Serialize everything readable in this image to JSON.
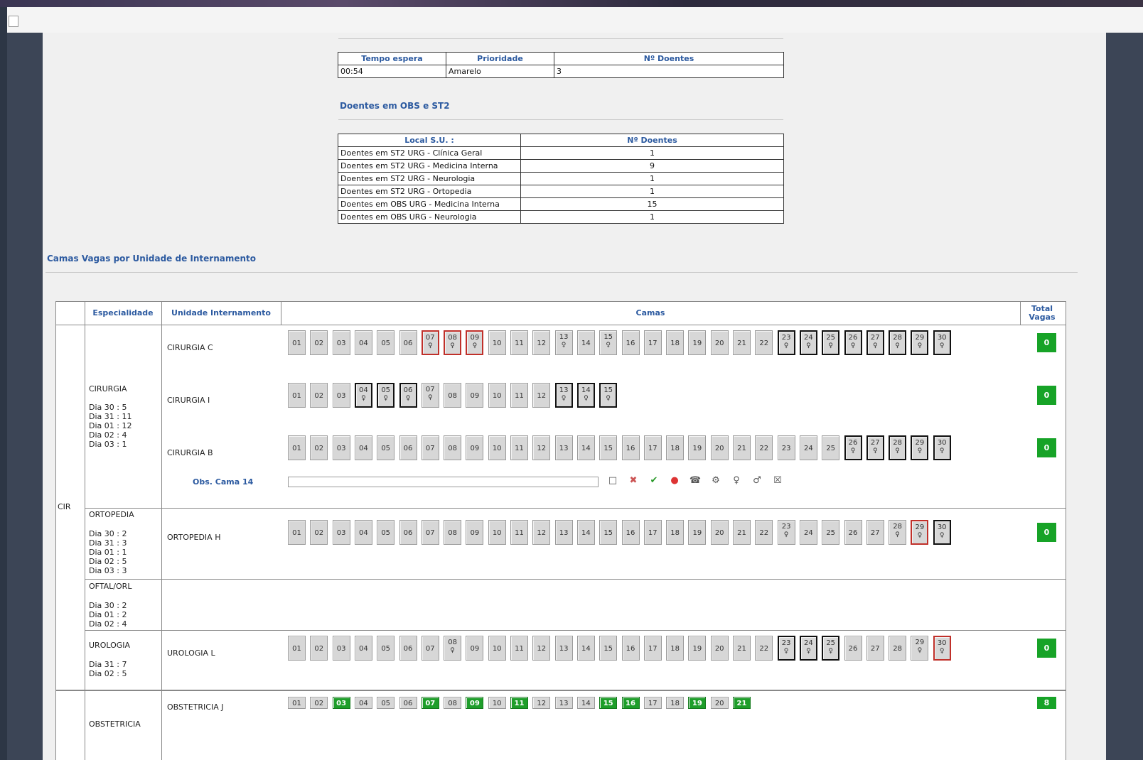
{
  "wait_table": {
    "headers": [
      "Tempo espera",
      "Prioridade",
      "Nº Doentes"
    ],
    "row": [
      "00:54",
      "Amarelo",
      "3"
    ]
  },
  "obs_section": {
    "title": "Doentes em OBS e ST2",
    "headers": [
      "Local S.U. :",
      "Nº Doentes"
    ],
    "rows": [
      [
        "Doentes em ST2 URG - Clínica Geral",
        "1"
      ],
      [
        "Doentes em ST2 URG - Medicina Interna",
        "9"
      ],
      [
        "Doentes em ST2 URG - Neurologia",
        "1"
      ],
      [
        "Doentes em ST2 URG - Ortopedia",
        "1"
      ],
      [
        "Doentes em OBS URG - Medicina Interna",
        "15"
      ],
      [
        "Doentes em OBS URG - Neurologia",
        "1"
      ]
    ]
  },
  "beds_section": {
    "title": "Camas Vagas por Unidade de Internamento",
    "headers": {
      "especialidade": "Especialidade",
      "unidade": "Unidade Internamento",
      "camas": "Camas",
      "total": "Total Vagas"
    },
    "group": "CIR",
    "specialties": [
      {
        "name": "CIRURGIA",
        "stats": "Dia 30 : 5\nDia 31 : 11\nDia 01 : 12\nDia 02 : 4\nDia 03 : 1"
      },
      {
        "name": "ORTOPEDIA",
        "stats": "Dia 30 : 2\nDia 31 : 3\nDia 01 : 1\nDia 02 : 5\nDia 03 : 3"
      },
      {
        "name": "OFTAL/ORL",
        "stats": "Dia 30 : 2\nDia 01 : 2\nDia 02 : 4"
      },
      {
        "name": "UROLOGIA",
        "stats": "Dia 31 : 7\nDia 02 : 5"
      },
      {
        "name": "OBSTETRICIA",
        "stats": ""
      }
    ],
    "units": [
      {
        "name": "CIRURGIA C",
        "total": "0",
        "beds": [
          "01",
          "02",
          "03",
          "04",
          "05",
          "06",
          "07",
          "08",
          "09",
          "10",
          "11",
          "12",
          "13",
          "14",
          "15",
          "16",
          "17",
          "18",
          "19",
          "20",
          "21",
          "22",
          "23",
          "24",
          "25",
          "26",
          "27",
          "28",
          "29",
          "30"
        ],
        "occupied": [
          "13",
          "15"
        ],
        "occupied_bold": [
          "23",
          "24",
          "25",
          "26",
          "27",
          "28",
          "29",
          "30"
        ],
        "red": [
          "07",
          "08",
          "09"
        ]
      },
      {
        "name": "CIRURGIA I",
        "total": "0",
        "beds": [
          "01",
          "02",
          "03",
          "04",
          "05",
          "06",
          "07",
          "08",
          "09",
          "10",
          "11",
          "12",
          "13",
          "14",
          "15"
        ],
        "occupied": [
          "07"
        ],
        "occupied_bold": [
          "04",
          "05",
          "06",
          "13",
          "14",
          "15"
        ],
        "red": []
      },
      {
        "name": "CIRURGIA B",
        "total": "0",
        "beds": [
          "01",
          "02",
          "03",
          "04",
          "05",
          "06",
          "07",
          "08",
          "09",
          "10",
          "11",
          "12",
          "13",
          "14",
          "15",
          "16",
          "17",
          "18",
          "19",
          "20",
          "21",
          "22",
          "23",
          "24",
          "25",
          "26",
          "27",
          "28",
          "29",
          "30"
        ],
        "occupied": [],
        "occupied_bold": [
          "26",
          "27",
          "28",
          "29",
          "30"
        ],
        "red": []
      },
      {
        "name": "ORTOPEDIA H",
        "total": "0",
        "beds": [
          "01",
          "02",
          "03",
          "04",
          "05",
          "06",
          "07",
          "08",
          "09",
          "10",
          "11",
          "12",
          "13",
          "14",
          "15",
          "16",
          "17",
          "18",
          "19",
          "20",
          "21",
          "22",
          "23",
          "24",
          "25",
          "26",
          "27",
          "28",
          "29",
          "30"
        ],
        "occupied": [
          "23",
          "28"
        ],
        "occupied_bold": [
          "30"
        ],
        "red": [
          "29"
        ]
      },
      {
        "name": "UROLOGIA L",
        "total": "0",
        "beds": [
          "01",
          "02",
          "03",
          "04",
          "05",
          "06",
          "07",
          "08",
          "09",
          "10",
          "11",
          "12",
          "13",
          "14",
          "15",
          "16",
          "17",
          "18",
          "19",
          "20",
          "21",
          "22",
          "23",
          "24",
          "25",
          "26",
          "27",
          "28",
          "29",
          "30"
        ],
        "occupied": [
          "08",
          "29"
        ],
        "occupied_bold": [
          "23",
          "24",
          "25"
        ],
        "red": [
          "30"
        ]
      },
      {
        "name": "OBSTETRICIA J",
        "total": "8",
        "beds": [
          "01",
          "02",
          "03",
          "04",
          "05",
          "06",
          "07",
          "08",
          "09",
          "10",
          "11",
          "12",
          "13",
          "14",
          "15",
          "16",
          "17",
          "18",
          "19",
          "20",
          "21"
        ],
        "green": [
          "03",
          "07",
          "09",
          "11",
          "15",
          "16",
          "19",
          "21"
        ]
      }
    ],
    "obs_bed_label": "Obs. Cama 14",
    "obs_input_value": "",
    "tool_icons": [
      "document-icon",
      "delete-icon",
      "check-icon",
      "stop-icon",
      "phone-icon",
      "settings-icon",
      "female-icon",
      "male-icon",
      "close-icon"
    ]
  },
  "colors": {
    "accent": "#2c5aa0",
    "free_bed": "#17a327",
    "red_bed": "#c0302a"
  }
}
